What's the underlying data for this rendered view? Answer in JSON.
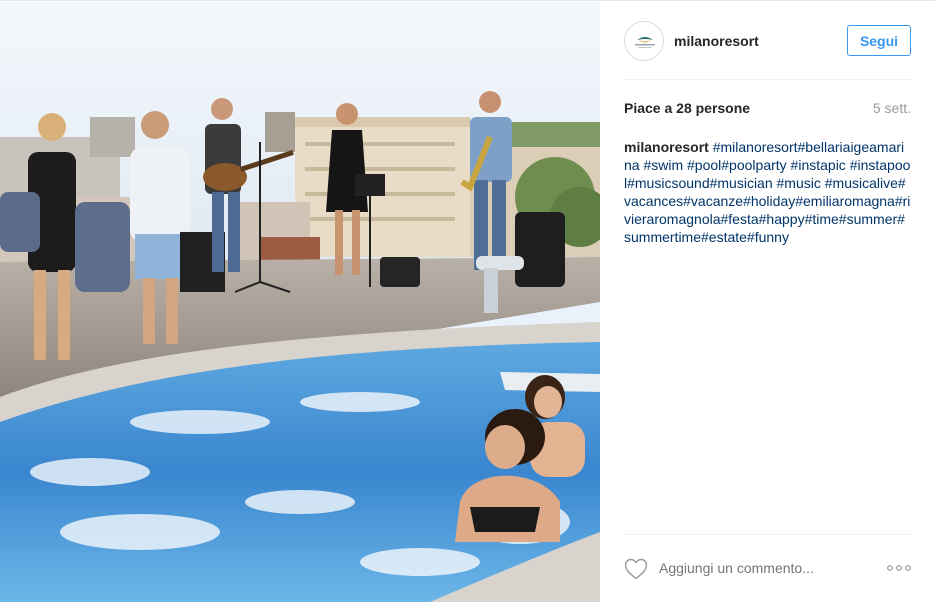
{
  "account": {
    "username": "milanoresort",
    "follow_label": "Segui"
  },
  "post": {
    "likes": "Piace a 28 persone",
    "time_ago": "5 sett.",
    "caption_user": "milanoresort",
    "caption_text": "#milanoresort#bellariaigeamarina #swim #pool#poolparty #instapic #instapool#musicsound#musician #music #musicalive#vacances#vacanze#holiday#emiliaromagna#rivieraromagnola#festa#happy#time#summer#summertime#estate#funny"
  },
  "comment": {
    "placeholder": "Aggiungi un commento..."
  },
  "icons": {
    "like": "heart-icon",
    "more": "more-options-icon"
  },
  "colors": {
    "follow_blue": "#3897f0",
    "hashtag": "#003569",
    "muted": "#999999"
  }
}
